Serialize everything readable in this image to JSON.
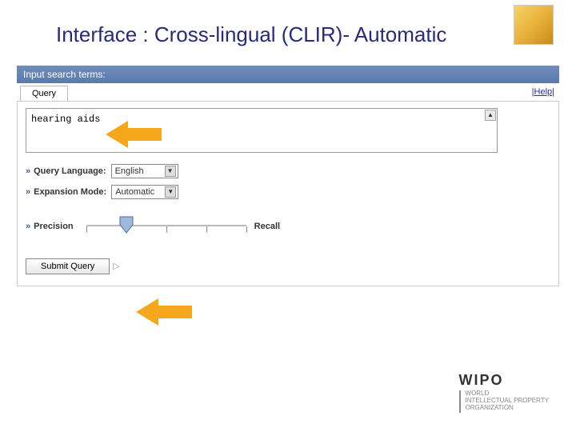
{
  "slide": {
    "title": "Interface : Cross-lingual (CLIR)- Automatic"
  },
  "panel": {
    "header": "Input search terms:",
    "tab_query": "Query",
    "help": "|Help|"
  },
  "form": {
    "query_value": "hearing aids",
    "query_language_label": "Query Language:",
    "query_language_value": "English",
    "expansion_mode_label": "Expansion Mode:",
    "expansion_mode_value": "Automatic",
    "precision_label": "Precision",
    "recall_label": "Recall",
    "submit_label": "Submit Query"
  },
  "footer": {
    "brand": "WIPO",
    "line1": "WORLD",
    "line2": "INTELLECTUAL PROPERTY",
    "line3": "ORGANIZATION"
  }
}
